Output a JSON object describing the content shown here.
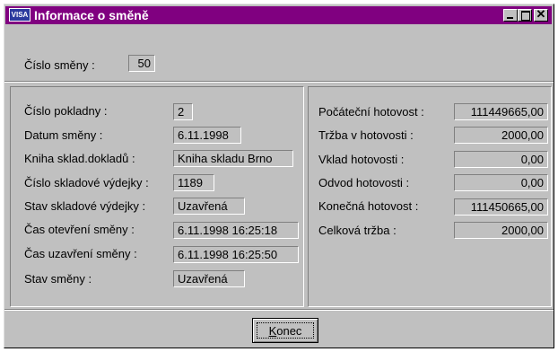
{
  "window": {
    "title": "Informace o směně",
    "icon_text": "VISA",
    "controls": {
      "minimize": "minimize-icon",
      "maximize": "maximize-icon",
      "close": "close-icon"
    }
  },
  "header": {
    "shift_number_label": "Číslo směny :",
    "shift_number_value": "50"
  },
  "left": {
    "register_label": "Číslo pokladny :",
    "register_value": "2",
    "date_label": "Datum směny :",
    "date_value": "6.11.1998",
    "book_label": "Kniha sklad.dokladů :",
    "book_value": "Kniha skladu Brno",
    "issue_number_label": "Číslo skladové výdejky :",
    "issue_number_value": "1189",
    "issue_state_label": "Stav skladové výdejky :",
    "issue_state_value": "Uzavřená",
    "open_time_label": "Čas otevření směny :",
    "open_time_value": "6.11.1998 16:25:18",
    "close_time_label": "Čas uzavření směny :",
    "close_time_value": "6.11.1998 16:25:50",
    "shift_state_label": "Stav směny :",
    "shift_state_value": "Uzavřená"
  },
  "right": {
    "initial_cash_label": "Počáteční hotovost :",
    "initial_cash_value": "111449665,00",
    "cash_sales_label": "Tržba v hotovosti :",
    "cash_sales_value": "2000,00",
    "cash_deposit_label": "Vklad hotovosti :",
    "cash_deposit_value": "0,00",
    "cash_withdrawal_label": "Odvod hotovosti :",
    "cash_withdrawal_value": "0,00",
    "final_cash_label": "Konečná hotovost :",
    "final_cash_value": "111450665,00",
    "total_sales_label": "Celková tržba :",
    "total_sales_value": "2000,00"
  },
  "footer": {
    "close_button_accel": "K",
    "close_button_rest": "onec"
  }
}
